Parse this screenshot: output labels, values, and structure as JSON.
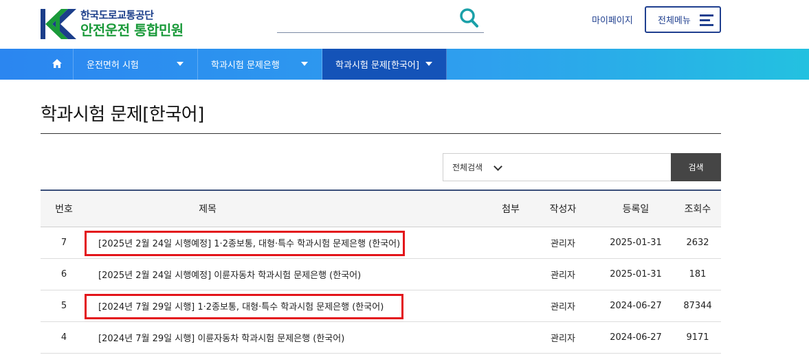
{
  "header": {
    "logo_top": "한국도로교통공단",
    "logo_bottom": "안전운전 통합민원",
    "search_icon": "search-icon",
    "mypage_label": "마이페이지",
    "allmenu_label": "전체메뉴"
  },
  "nav": {
    "home_icon": "home-icon",
    "items": [
      {
        "label": "운전면허 시험"
      },
      {
        "label": "학과시험 문제은행"
      },
      {
        "label": "학과시험 문제[한국어]"
      }
    ]
  },
  "page": {
    "title": "학과시험 문제[한국어]"
  },
  "search": {
    "select_label": "전체검색",
    "input_value": "",
    "button_label": "검색"
  },
  "table": {
    "headers": {
      "no": "번호",
      "title": "제목",
      "attach": "첨부",
      "author": "작성자",
      "date": "등록일",
      "views": "조회수"
    },
    "rows": [
      {
        "no": "7",
        "title": "[2025년 2월 24일 시행예정] 1·2종보통, 대형·특수 학과시험 문제은행 (한국어)",
        "author": "관리자",
        "date": "2025-01-31",
        "views": "2632",
        "highlighted": true
      },
      {
        "no": "6",
        "title": "[2025년 2월 24일 시행예정] 이륜자동차 학과시험 문제은행 (한국어)",
        "author": "관리자",
        "date": "2025-01-31",
        "views": "181",
        "highlighted": false
      },
      {
        "no": "5",
        "title": "[2024년 7월 29일 시행] 1·2종보통, 대형·특수 학과시험 문제은행 (한국어)",
        "author": "관리자",
        "date": "2024-06-27",
        "views": "87344",
        "highlighted": true
      },
      {
        "no": "4",
        "title": "[2024년 7월 29일 시행] 이륜자동차 학과시험 문제은행 (한국어)",
        "author": "관리자",
        "date": "2024-06-27",
        "views": "9171",
        "highlighted": false
      }
    ]
  },
  "colors": {
    "brand_blue": "#1f3f8f",
    "brand_green": "#1a9a3a",
    "nav_active": "#1453b8",
    "highlight": "#e3141a"
  }
}
